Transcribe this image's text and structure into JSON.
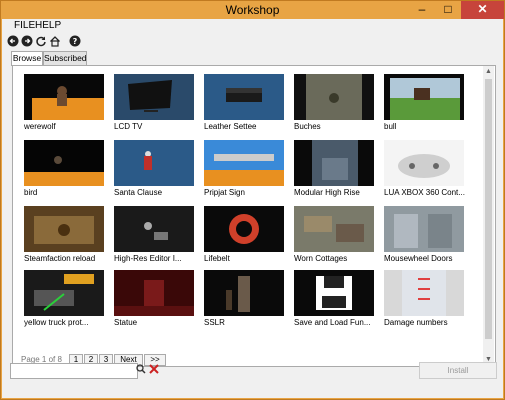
{
  "window": {
    "title": "Workshop",
    "controls": {
      "minimize": "–",
      "maximize": "□",
      "close": "✕"
    }
  },
  "menu": [
    "FILE",
    "HELP"
  ],
  "toolbar": [
    "back-icon",
    "forward-icon",
    "refresh-icon",
    "home-icon",
    "help-icon"
  ],
  "tabs": [
    {
      "label": "Browse",
      "active": true
    },
    {
      "label": "Subscribed",
      "active": false
    }
  ],
  "items": [
    "werewolf",
    "LCD TV",
    "Leather Settee",
    "Buches",
    "bull",
    "bird",
    "Santa Clause",
    "Pripjat Sign",
    "Modular High Rise",
    "LUA XBOX 360 Cont...",
    "Steamfaction reload",
    "High-Res Editor I...",
    "Lifebelt",
    "Worn Cottages",
    "Mousewheel Doors",
    "yellow truck prot...",
    "Statue",
    "SSLR",
    "Save and Load Fun...",
    "Damage numbers"
  ],
  "pager": {
    "text": "Page 1 of 8",
    "pages": [
      "1",
      "2",
      "3"
    ],
    "next": "Next",
    "last": ">>"
  },
  "search": {
    "value": "",
    "placeholder": ""
  },
  "install_label": "Install",
  "colors": {
    "titlebar": "#e8a444",
    "close": "#c7443b",
    "panel": "#ffffff"
  }
}
